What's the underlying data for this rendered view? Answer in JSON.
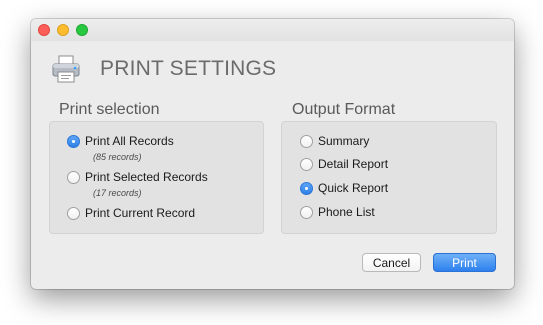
{
  "window": {
    "traffic_lights": [
      "close",
      "minimize",
      "zoom"
    ],
    "colors": {
      "close": "#fc5f57",
      "minimize": "#fdbc2e",
      "zoom": "#28c840"
    }
  },
  "header": {
    "icon": "printer-icon",
    "title": "PRINT SETTINGS"
  },
  "print_selection": {
    "title": "Print selection",
    "options": [
      {
        "label": "Print All Records",
        "sublabel": "(85 records)",
        "selected": true
      },
      {
        "label": "Print Selected Records",
        "sublabel": "(17 records)",
        "selected": false
      },
      {
        "label": "Print Current Record",
        "selected": false
      }
    ]
  },
  "output_format": {
    "title": "Output Format",
    "options": [
      {
        "label": "Summary",
        "selected": false
      },
      {
        "label": "Detail Report",
        "selected": false
      },
      {
        "label": "Quick Report",
        "selected": true
      },
      {
        "label": "Phone List",
        "selected": false
      }
    ]
  },
  "buttons": {
    "cancel": "Cancel",
    "print": "Print"
  },
  "accent_color": "#2f81e8"
}
